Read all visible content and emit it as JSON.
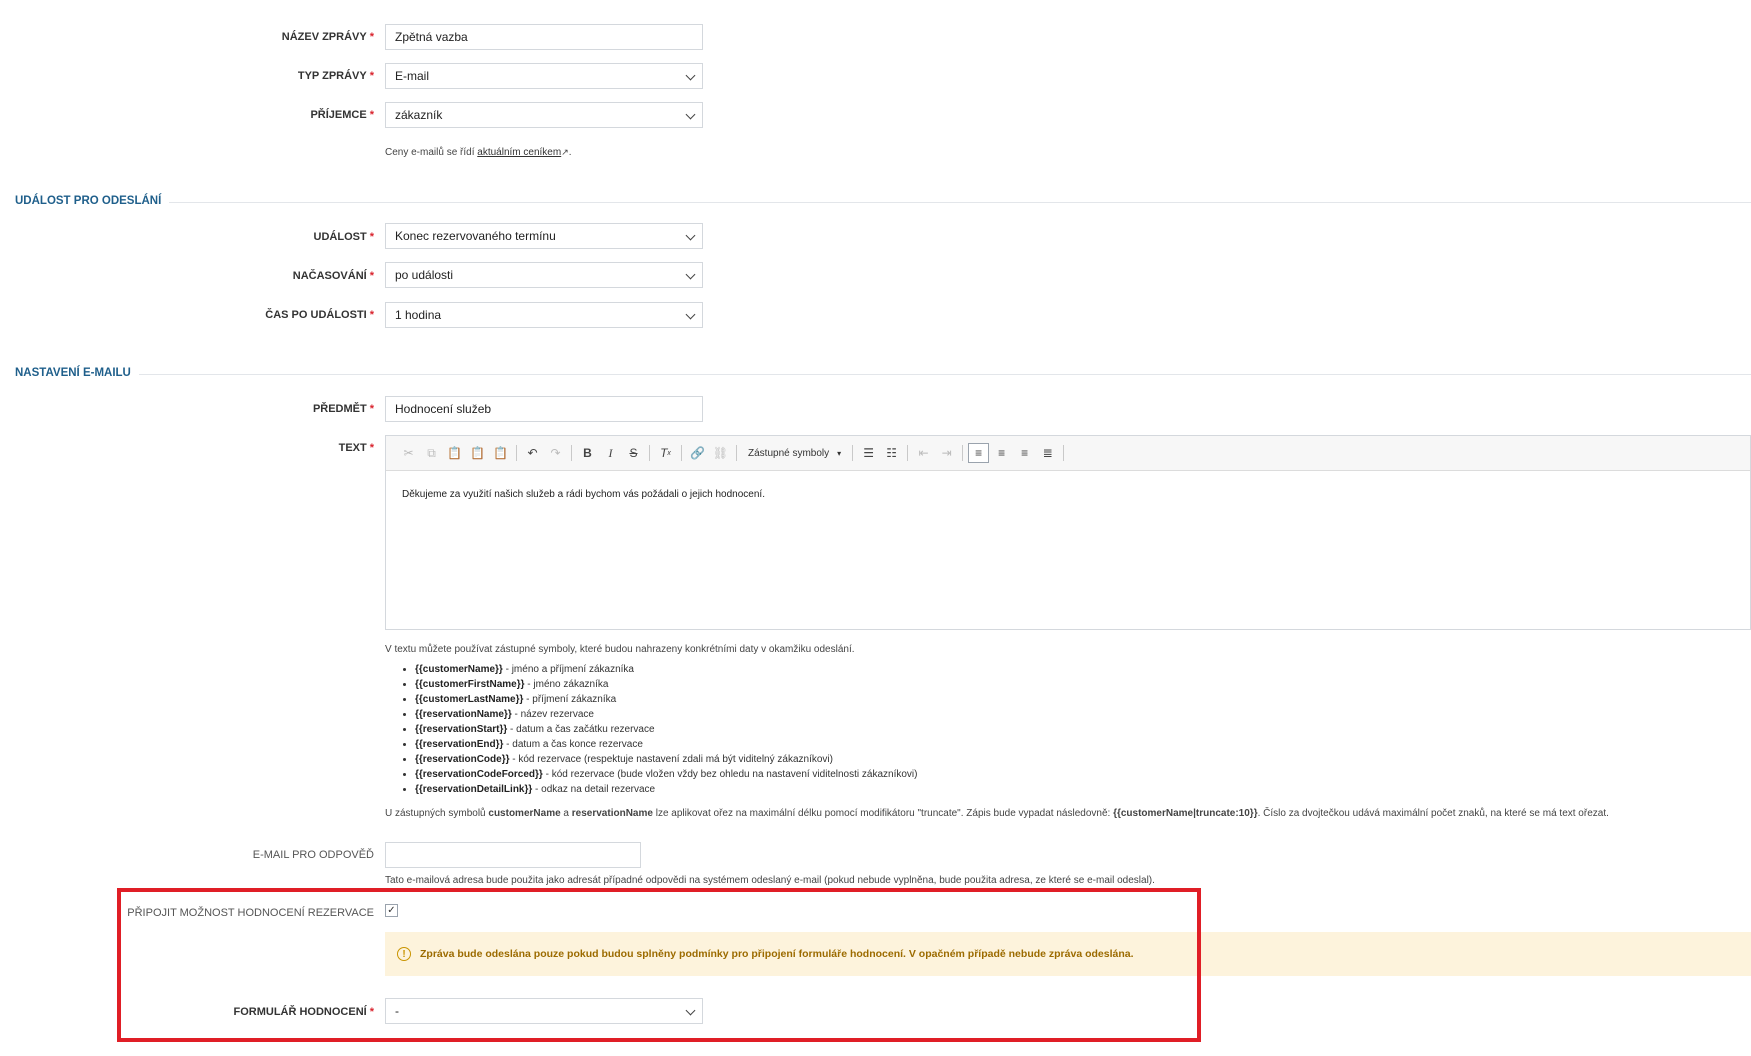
{
  "fields": {
    "message_name": {
      "label": "NÁZEV ZPRÁVY",
      "value": "Zpětná vazba"
    },
    "message_type": {
      "label": "TYP ZPRÁVY",
      "value": "E-mail"
    },
    "recipient": {
      "label": "PŘÍJEMCE",
      "value": "zákazník"
    },
    "pricing_note": {
      "prefix": "Ceny e-mailů se řídí",
      "link": "aktuálním ceníkem",
      "suffix": "."
    }
  },
  "event_section": {
    "title": "UDÁLOST PRO ODESLÁNÍ",
    "event": {
      "label": "UDÁLOST",
      "value": "Konec rezervovaného termínu"
    },
    "timing": {
      "label": "NAČASOVÁNÍ",
      "value": "po události"
    },
    "time_after": {
      "label": "ČAS PO UDÁLOSTI",
      "value": "1 hodina"
    }
  },
  "email_section": {
    "title": "NASTAVENÍ E-MAILU",
    "subject": {
      "label": "PŘEDMĚT",
      "value": "Hodnocení služeb"
    },
    "text": {
      "label": "TEXT",
      "toolbar_combo": "Zástupné symboly",
      "body": "Děkujeme za využití našich služeb a rádi bychom vás požádali o jejich hodnocení."
    },
    "symbols_intro": "V textu můžete používat zástupné symboly, které budou nahrazeny konkrétními daty v okamžiku odeslání.",
    "symbols": [
      {
        "name": "{{customerName}}",
        "desc": " - jméno a příjmení zákazníka"
      },
      {
        "name": "{{customerFirstName}}",
        "desc": " - jméno zákazníka"
      },
      {
        "name": "{{customerLastName}}",
        "desc": " - příjmení zákazníka"
      },
      {
        "name": "{{reservationName}}",
        "desc": " - název rezervace"
      },
      {
        "name": "{{reservationStart}}",
        "desc": " - datum a čas začátku rezervace"
      },
      {
        "name": "{{reservationEnd}}",
        "desc": " - datum a čas konce rezervace"
      },
      {
        "name": "{{reservationCode}}",
        "desc": " - kód rezervace (respektuje nastavení zdali má být viditelný zákazníkovi)"
      },
      {
        "name": "{{reservationCodeForced}}",
        "desc": " - kód rezervace (bude vložen vždy bez ohledu na nastavení viditelnosti zákazníkovi)"
      },
      {
        "name": "{{reservationDetailLink}}",
        "desc": " - odkaz na detail rezervace"
      }
    ],
    "truncate_note": {
      "p1": "U zástupných symbolů ",
      "b1": "customerName",
      "p2": " a ",
      "b2": "reservationName",
      "p3": " lze aplikovat ořez na maximální délku pomocí modifikátoru \"truncate\". Zápis bude vypadat následovně: ",
      "b3": "{{customerName|truncate:10}}",
      "p4": ". Číslo za dvojtečkou udává maximální počet znaků, na které se má text ořezat."
    },
    "reply_email": {
      "label": "E-MAIL PRO ODPOVĚĎ",
      "value": "",
      "note": "Tato e-mailová adresa bude použita jako adresát případné odpovědi na systémem odeslaný e-mail (pokud nebude vyplněna, bude použita adresa, ze které se e-mail odeslal)."
    },
    "attach_rating": {
      "label": "PŘIPOJIT MOŽNOST HODNOCENÍ REZERVACE",
      "checked": true
    },
    "warning": "Zpráva bude odeslána pouze pokud budou splněny podmínky pro připojení formuláře hodnocení. V opačném případě nebude zpráva odeslána.",
    "rating_form": {
      "label": "FORMULÁŘ HODNOCENÍ",
      "value": "-"
    }
  },
  "colors": {
    "accent": "#1f5f8b",
    "required": "#d9232d",
    "highlight": "#e01e26",
    "warning_bg": "#fdf3dc"
  }
}
